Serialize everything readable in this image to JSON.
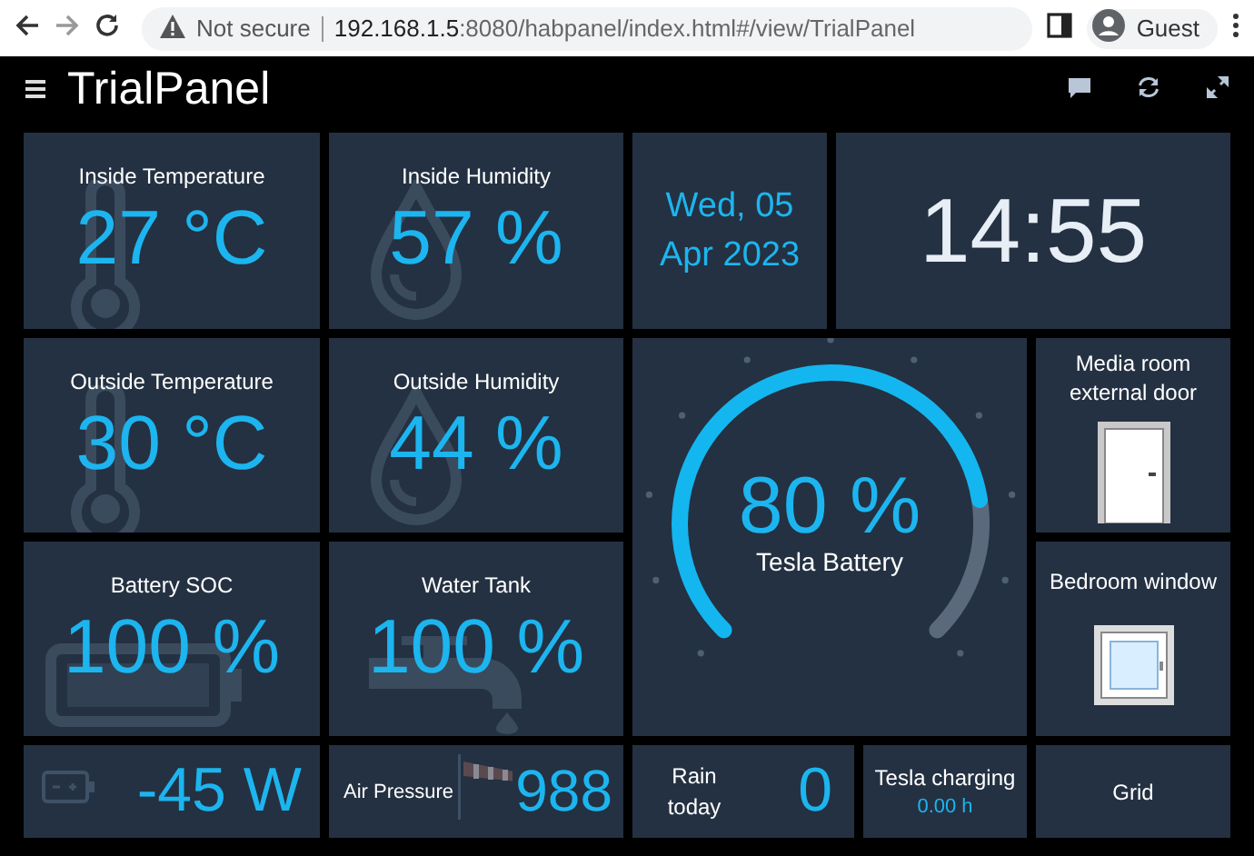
{
  "browser": {
    "security": "Not secure",
    "host": "192.168.1.5",
    "path": ":8080/habpanel/index.html#/view/TrialPanel",
    "profile": "Guest"
  },
  "panel": {
    "title": "TrialPanel"
  },
  "tiles": [
    {
      "kind": "sensor",
      "title": "Inside Temperature",
      "value": "27 °C"
    },
    {
      "kind": "sensor",
      "title": "Inside Humidity",
      "value": "57 %"
    },
    {
      "kind": "date",
      "line_1": "Wed, 05",
      "line_2": "Apr 2023"
    },
    {
      "kind": "clock",
      "value": "14:55"
    },
    {
      "kind": "sensor",
      "title": "Outside Temperature",
      "value": "30 °C"
    },
    {
      "kind": "sensor",
      "title": "Outside Humidity",
      "value": "44 %"
    },
    {
      "kind": "gauge",
      "value": "80 %",
      "label": "Tesla Battery"
    },
    {
      "kind": "image",
      "title": "Media room external door"
    },
    {
      "kind": "sensor",
      "title": "Battery SOC",
      "value": "100 %"
    },
    {
      "kind": "sensor",
      "title": "Water Tank",
      "value": "100 %"
    },
    {
      "kind": "image",
      "title": "Bedroom window"
    },
    {
      "kind": "power",
      "value": "-45 W"
    },
    {
      "kind": "pressure",
      "title": "Air Pressure",
      "value": "988"
    },
    {
      "kind": "rain",
      "title": "Rain today",
      "value": "0"
    },
    {
      "kind": "charging",
      "title": "Tesla charging",
      "value": "0.00 h"
    },
    {
      "kind": "button",
      "title": "Grid"
    }
  ]
}
